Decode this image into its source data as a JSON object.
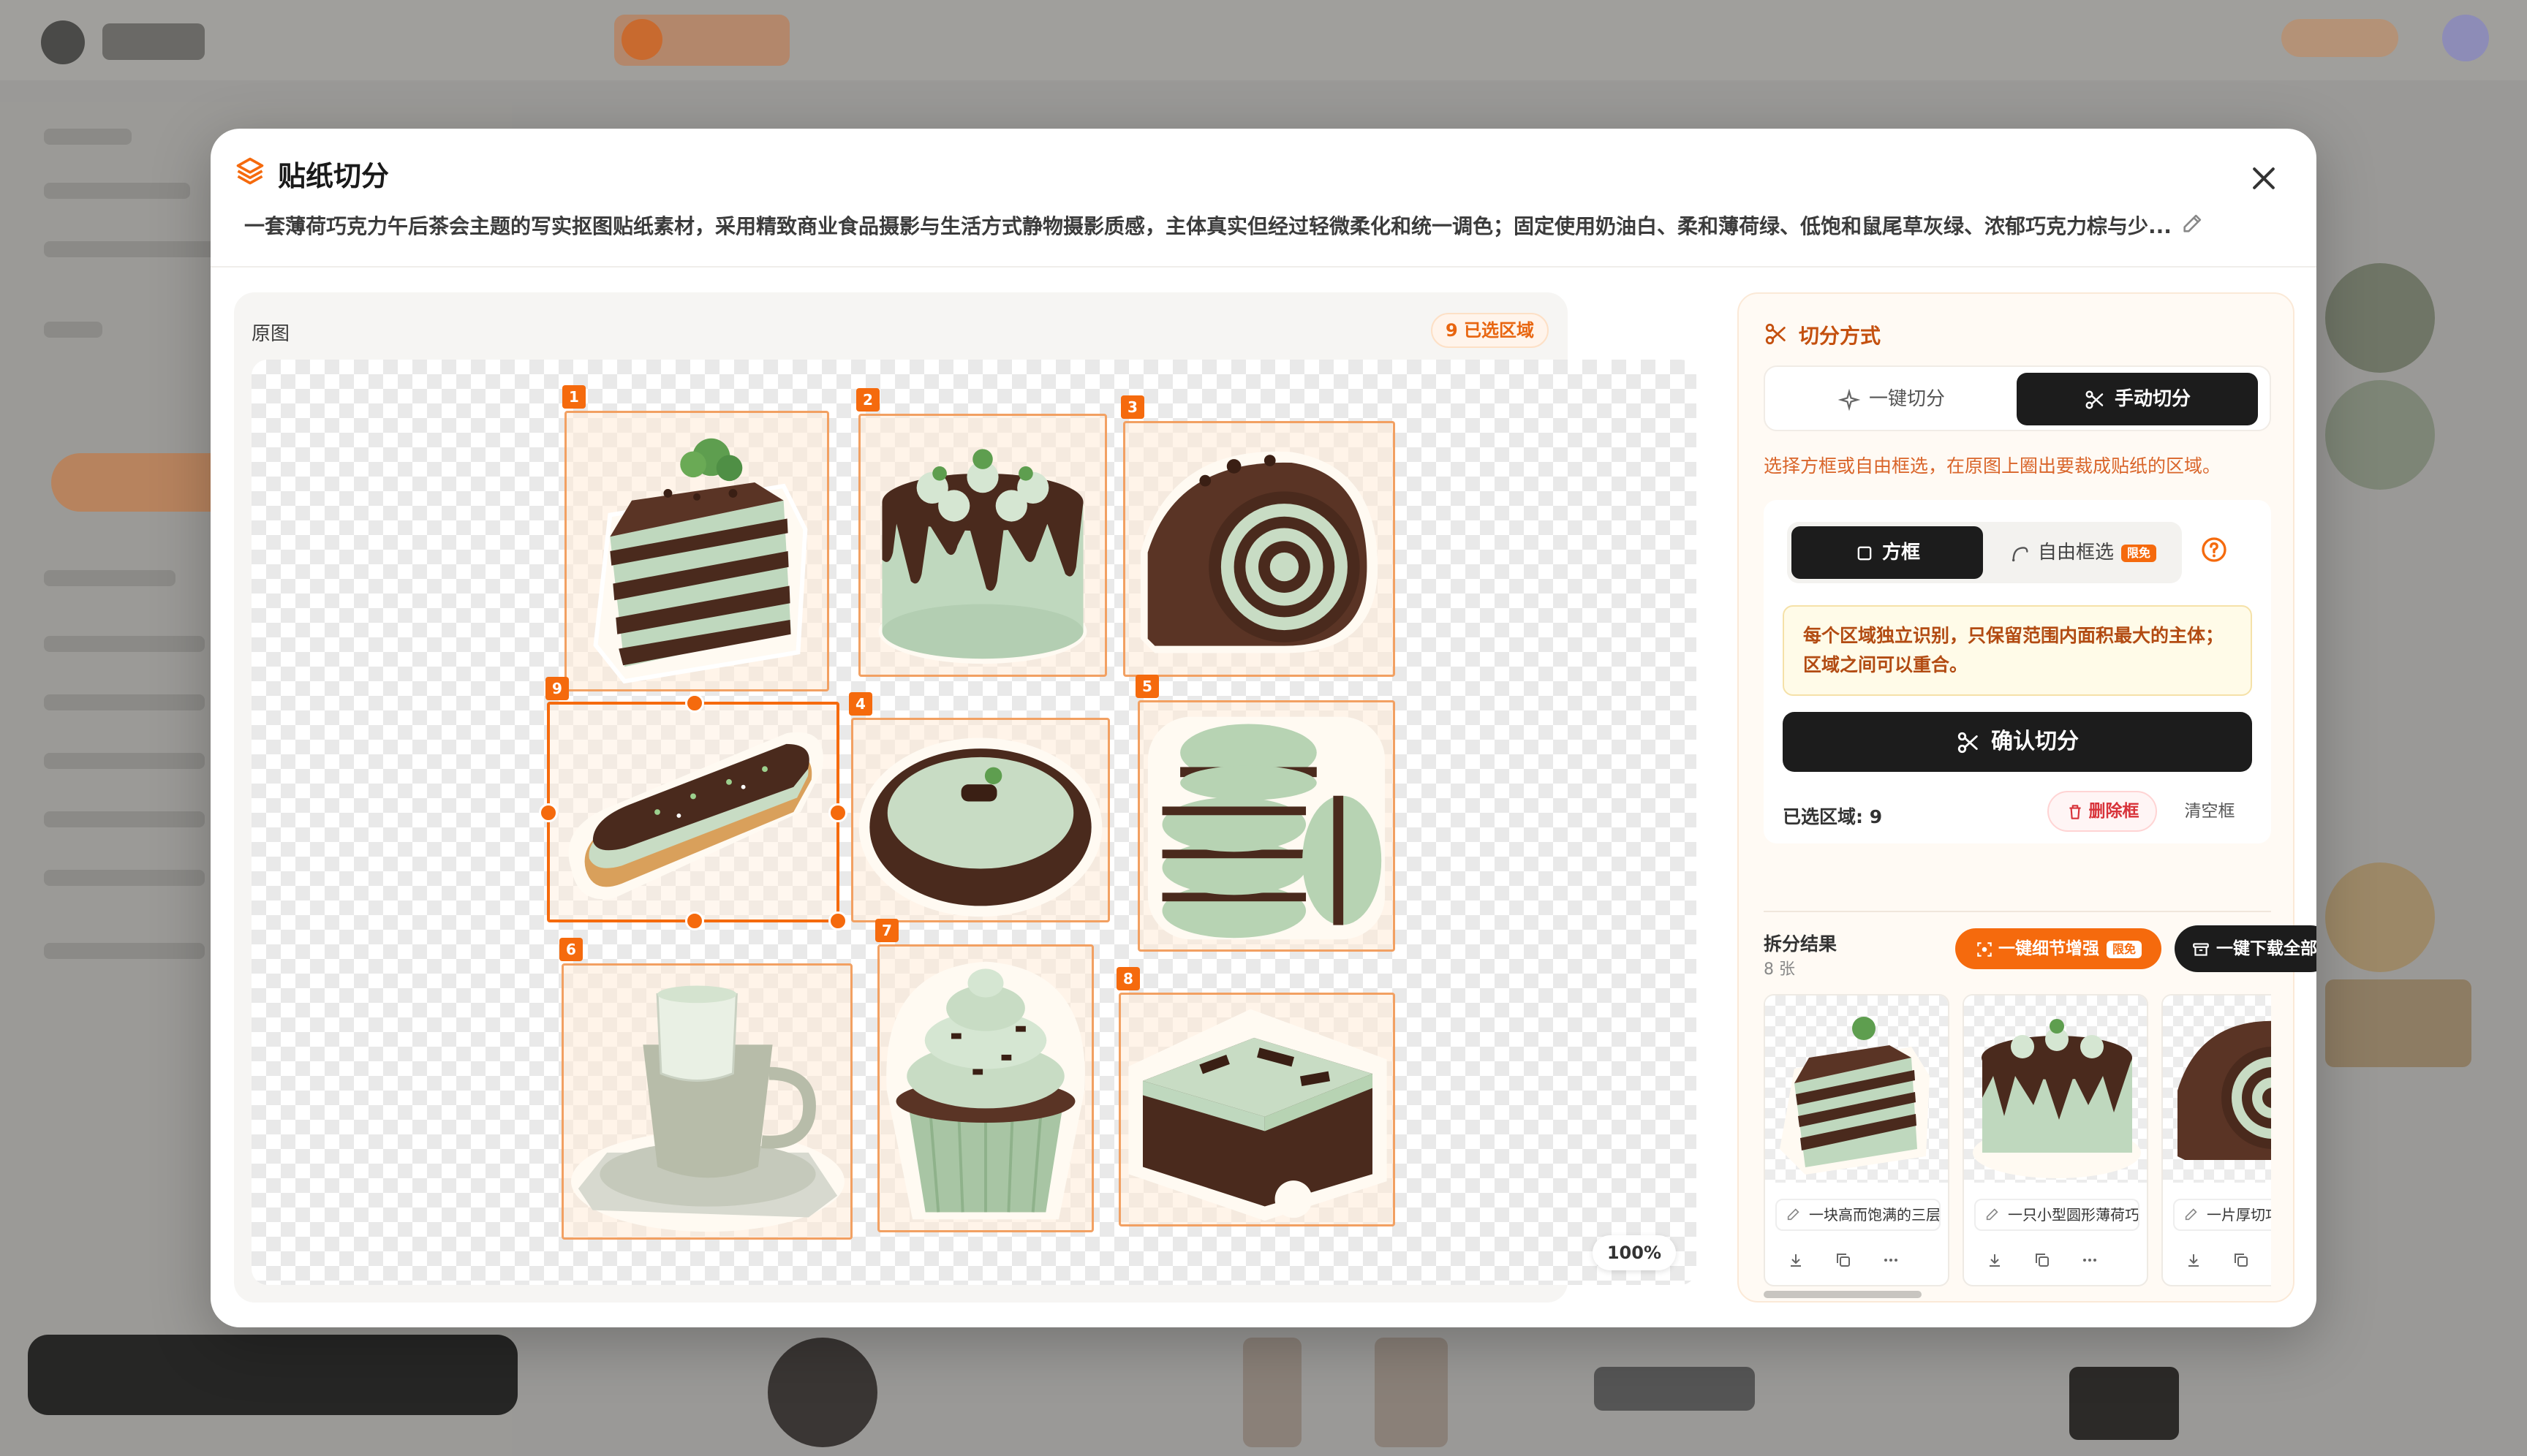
{
  "modal": {
    "title": "贴纸切分",
    "description": "一套薄荷巧克力午后茶会主题的写实抠图贴纸素材，采用精致商业食品摄影与生活方式静物摄影质感，主体真实但经过轻微柔化和统一调色；固定使用奶油白、柔和薄荷绿、低饱和鼠尾草灰绿、浓郁巧克力棕与少..."
  },
  "left_panel": {
    "label": "原图",
    "region_badge": "9 已选区域",
    "zoom": "100%",
    "stickers": [
      {
        "num": "1",
        "name": "layer-cake-slice"
      },
      {
        "num": "2",
        "name": "drip-cake"
      },
      {
        "num": "3",
        "name": "swiss-roll"
      },
      {
        "num": "4",
        "name": "mint-tart"
      },
      {
        "num": "5",
        "name": "macaron-stack"
      },
      {
        "num": "6",
        "name": "mint-latte-cup"
      },
      {
        "num": "7",
        "name": "mint-cupcake"
      },
      {
        "num": "8",
        "name": "mint-brownie"
      },
      {
        "num": "9",
        "name": "chocolate-eclair"
      }
    ]
  },
  "right_panel": {
    "title": "切分方式",
    "mode_tabs": [
      "一键切分",
      "手动切分"
    ],
    "active_mode": "手动切分",
    "hint": "选择方框或自由框选，在原图上圈出要裁成贴纸的区域。",
    "shape_tabs": [
      "方框",
      "自由框选"
    ],
    "limited_tag": "限免",
    "note": "每个区域独立识别，只保留范围内面积最大的主体；区域之间可以重合。",
    "confirm": "确认切分",
    "selected_count": "已选区域: 9",
    "delete": "删除框",
    "clear": "清空框",
    "results_title": "拆分结果",
    "results_count": "8 张",
    "enhance": "一键细节增强",
    "download_all": "一键下载全部",
    "results": [
      {
        "name": "一块高而饱满的三层薄荷巧克力蛋糕"
      },
      {
        "name": "一只小型圆形薄荷巧克力淋面蛋糕"
      },
      {
        "name": "一片厚切巧克力薄荷蛋糕卷"
      }
    ]
  },
  "colors": {
    "accent": "#f56a0d",
    "dark": "#1c1c1c",
    "mint": "#bfd8be",
    "chocolate": "#4a2a1d"
  }
}
